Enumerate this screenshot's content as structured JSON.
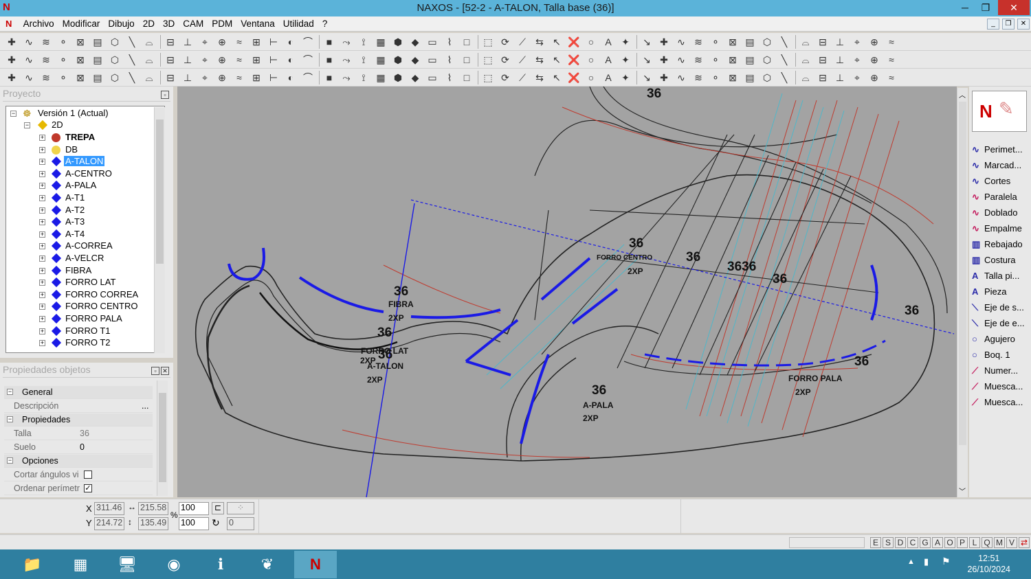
{
  "app": {
    "title": "NAXOS - [52-2 - A-TALON, Talla base (36)]",
    "logo": "N"
  },
  "window_buttons": {
    "minimize": "─",
    "maximize": "❐",
    "close": "✕"
  },
  "menu": [
    "Archivo",
    "Modificar",
    "Dibujo",
    "2D",
    "3D",
    "CAM",
    "PDM",
    "Ventana",
    "Utilidad",
    "?"
  ],
  "project_panel": {
    "title": "Proyecto",
    "root": "Versión 1 (Actual)",
    "folder": "2D",
    "items": [
      {
        "label": "TREPA",
        "icon": "red-circle",
        "bold": true
      },
      {
        "label": "DB",
        "icon": "yellow-circle"
      },
      {
        "label": "A-TALON",
        "icon": "blue-diamond",
        "selected": true
      },
      {
        "label": "A-CENTRO",
        "icon": "blue-diamond"
      },
      {
        "label": "A-PALA",
        "icon": "blue-diamond"
      },
      {
        "label": "A-T1",
        "icon": "blue-diamond"
      },
      {
        "label": "A-T2",
        "icon": "blue-diamond"
      },
      {
        "label": "A-T3",
        "icon": "blue-diamond"
      },
      {
        "label": "A-T4",
        "icon": "blue-diamond"
      },
      {
        "label": "A-CORREA",
        "icon": "blue-diamond"
      },
      {
        "label": "A-VELCR",
        "icon": "blue-diamond"
      },
      {
        "label": "FIBRA",
        "icon": "blue-diamond"
      },
      {
        "label": "FORRO LAT",
        "icon": "blue-diamond"
      },
      {
        "label": "FORRO CORREA",
        "icon": "blue-diamond"
      },
      {
        "label": "FORRO CENTRO",
        "icon": "blue-diamond"
      },
      {
        "label": "FORRO PALA",
        "icon": "blue-diamond"
      },
      {
        "label": "FORRO T1",
        "icon": "blue-diamond"
      },
      {
        "label": "FORRO T2",
        "icon": "blue-diamond"
      }
    ]
  },
  "properties_panel": {
    "title": "Propiedades objetos",
    "groups": {
      "general": "General",
      "properties": "Propiedades",
      "options": "Opciones"
    },
    "rows": {
      "descripcion": {
        "key": "Descripción",
        "value": "..."
      },
      "talla": {
        "key": "Talla",
        "value": "36"
      },
      "suelo": {
        "key": "Suelo",
        "value": "0"
      },
      "cortar": {
        "key": "Cortar ángulos vi",
        "checked": false
      },
      "ordenar": {
        "key": "Ordenar perímetr",
        "checked": true
      }
    }
  },
  "canvas": {
    "labels": [
      {
        "text": "36",
        "kind": "big"
      },
      {
        "text": "36",
        "kind": "big"
      },
      {
        "text": "FIBRA",
        "kind": "small"
      },
      {
        "text": "2XP",
        "kind": "small"
      },
      {
        "text": "36",
        "kind": "big"
      },
      {
        "text": "FORRO LAT",
        "kind": "small"
      },
      {
        "text": "36",
        "kind": "big"
      },
      {
        "text": "A-TALON",
        "kind": "small"
      },
      {
        "text": "2XP",
        "kind": "small"
      },
      {
        "text": "2XP",
        "kind": "small"
      },
      {
        "text": "36",
        "kind": "big"
      },
      {
        "text": "A-PALA",
        "kind": "small"
      },
      {
        "text": "2XP",
        "kind": "small"
      },
      {
        "text": "36",
        "kind": "big"
      },
      {
        "text": "36",
        "kind": "big"
      },
      {
        "text": "3636",
        "kind": "big"
      },
      {
        "text": "36",
        "kind": "big"
      },
      {
        "text": "36",
        "kind": "big"
      },
      {
        "text": "36",
        "kind": "big"
      },
      {
        "text": "FORRO PALA",
        "kind": "small"
      },
      {
        "text": "2XP",
        "kind": "small"
      },
      {
        "text": "FORRO CENTRO",
        "kind": "tiny"
      },
      {
        "text": "2XP",
        "kind": "small"
      }
    ]
  },
  "palette": [
    {
      "label": "Perimet...",
      "icon": "curve-icon"
    },
    {
      "label": "Marcad...",
      "icon": "curve-icon"
    },
    {
      "label": "Cortes",
      "icon": "curve-icon"
    },
    {
      "label": "Paralela",
      "icon": "curve-icon"
    },
    {
      "label": "Doblado",
      "icon": "curve-icon"
    },
    {
      "label": "Empalme",
      "icon": "curve-icon"
    },
    {
      "label": "Rebajado",
      "icon": "stitch-icon"
    },
    {
      "label": "Costura",
      "icon": "stitch-icon"
    },
    {
      "label": "Talla pi...",
      "icon": "text-icon"
    },
    {
      "label": "Pieza",
      "icon": "text-icon"
    },
    {
      "label": "Eje de s...",
      "icon": "axis-icon"
    },
    {
      "label": "Eje de e...",
      "icon": "axis-icon"
    },
    {
      "label": "Agujero",
      "icon": "circle-icon"
    },
    {
      "label": "Boq. 1",
      "icon": "circle-icon"
    },
    {
      "label": "Numer...",
      "icon": "notch-icon"
    },
    {
      "label": "Muesca...",
      "icon": "notch-icon"
    },
    {
      "label": "Muesca...",
      "icon": "notch-icon"
    }
  ],
  "status": {
    "x_label": "X",
    "y_label": "Y",
    "x": "311.46",
    "y": "214.72",
    "width": "215.58",
    "height": "135.49",
    "scale_x": "100",
    "scale_y": "100",
    "percent": "%",
    "rotation": "0"
  },
  "status_flags": [
    "E",
    "S",
    "D",
    "C",
    "G",
    "A",
    "O",
    "P",
    "L",
    "Q",
    "M",
    "V"
  ],
  "taskbar": {
    "time": "12:51",
    "date": "26/10/2024"
  }
}
